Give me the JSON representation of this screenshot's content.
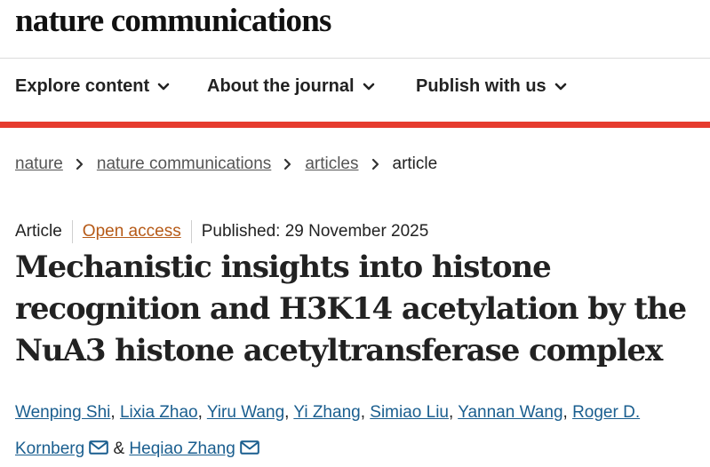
{
  "site": {
    "logo": "nature communications"
  },
  "nav": {
    "items": [
      "Explore content",
      "About the journal",
      "Publish with us"
    ]
  },
  "breadcrumb": [
    "nature",
    "nature communications",
    "articles",
    "article"
  ],
  "meta": {
    "type": "Article",
    "open_access": "Open access",
    "published": "Published: 29 November 2025"
  },
  "article": {
    "title_lines": [
      "Mechanistic insights into histone",
      "recognition and H3K14 acetylation by the",
      "NuA3 histone acetyltransferase complex"
    ],
    "authors": [
      "Wenping Shi",
      "Lixia Zhao",
      "Yiru Wang",
      "Yi Zhang",
      "Simiao Liu",
      "Yannan Wang",
      "Roger D.",
      "Kornberg",
      "Heqiao Zhang"
    ],
    "ampersand": "&",
    "separator": ","
  },
  "colors": {
    "accent_red": "#e63b2e",
    "author_link": "#1a5e8f",
    "open_access": "#b65a17"
  },
  "icons": {
    "nav_chevron": "chevron-down-icon",
    "breadcrumb_separator": "chevron-right-icon",
    "mail": "mail-icon"
  }
}
